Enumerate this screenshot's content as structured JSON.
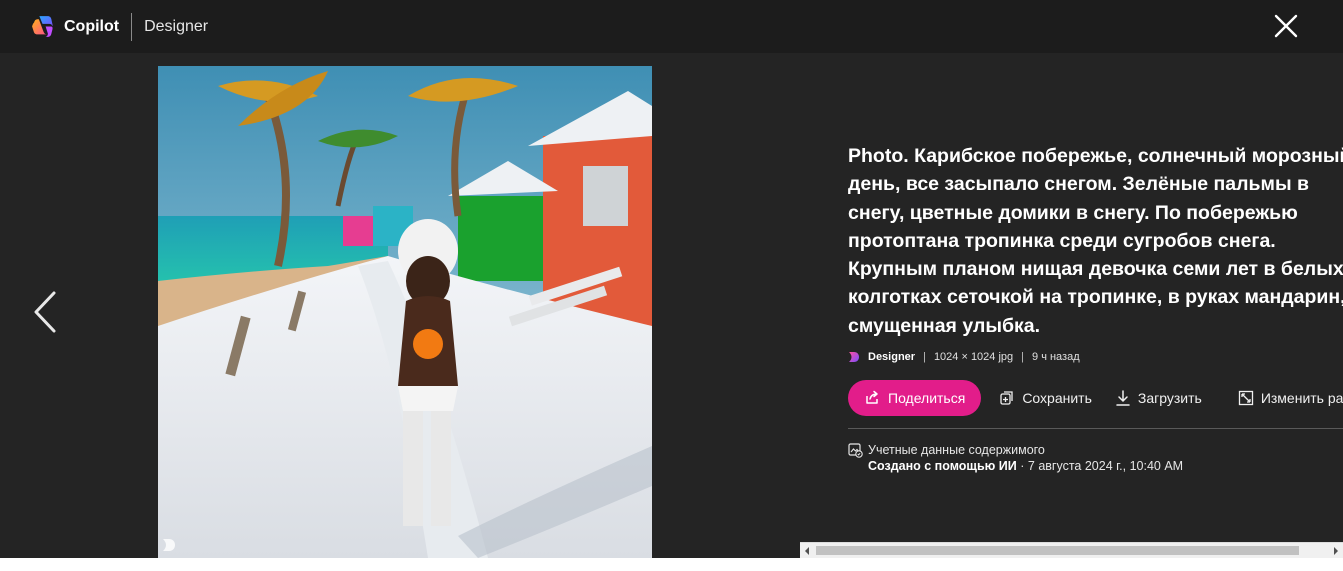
{
  "header": {
    "brand": "Copilot",
    "product": "Designer",
    "close_label": "Close"
  },
  "image": {
    "alt": "Сгенерированное изображение",
    "colors": {
      "sky": "#5aa9c4",
      "sea": "#1fb3a9",
      "snow": "#eef1f4"
    }
  },
  "details": {
    "prompt": "Photo. Карибское побережье, солнечный морозный день, все засыпало снегом. Зелёные пальмы в снегу, цветные домики в снегу. По побережью протоптана тропинка среди сугробов снега. Крупным планом нищая девочка семи лет в белых колготках сеточкой на тропинке, в руках мандарин, смущенная улыбка.",
    "source": "Designer",
    "size": "1024 × 1024 jpg",
    "time_ago": "9 ч назад"
  },
  "actions": {
    "share": "Поделиться",
    "save": "Сохранить",
    "download": "Загрузить",
    "resize": "Изменить раз"
  },
  "credentials": {
    "title": "Учетные данные содержимого",
    "created": "Создано с помощью ИИ",
    "date": " · 7 августа 2024 г., 10:40 AM"
  },
  "colors": {
    "accent": "#e21d8a",
    "background": "#242424",
    "topbar": "#1c1c1c"
  }
}
